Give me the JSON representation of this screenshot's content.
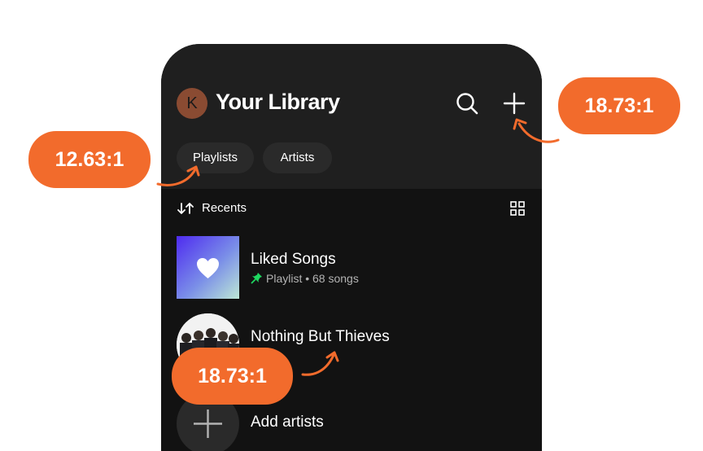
{
  "header": {
    "avatar_letter": "K",
    "title": "Your Library",
    "icons": [
      "search-icon",
      "plus-icon"
    ]
  },
  "filters": [
    {
      "label": "Playlists"
    },
    {
      "label": "Artists"
    }
  ],
  "sort": {
    "label": "Recents",
    "icon": "sort-arrows-icon",
    "view_icon": "grid-view-icon"
  },
  "items": [
    {
      "title": "Liked Songs",
      "subtitle": "Playlist • 68 songs",
      "icon": "heart-icon",
      "pinned": true
    },
    {
      "title": "Nothing But Thieves"
    },
    {
      "title": "Add artists",
      "icon": "plus-icon"
    }
  ],
  "annotations": [
    {
      "label": "12.63:1"
    },
    {
      "label": "18.73:1"
    },
    {
      "label": "18.73:1"
    }
  ],
  "colors": {
    "accent": "#f26b2c",
    "background": "#121212",
    "header": "#1f1f1f",
    "chip": "#2a2a2a",
    "pin": "#1ed760"
  }
}
